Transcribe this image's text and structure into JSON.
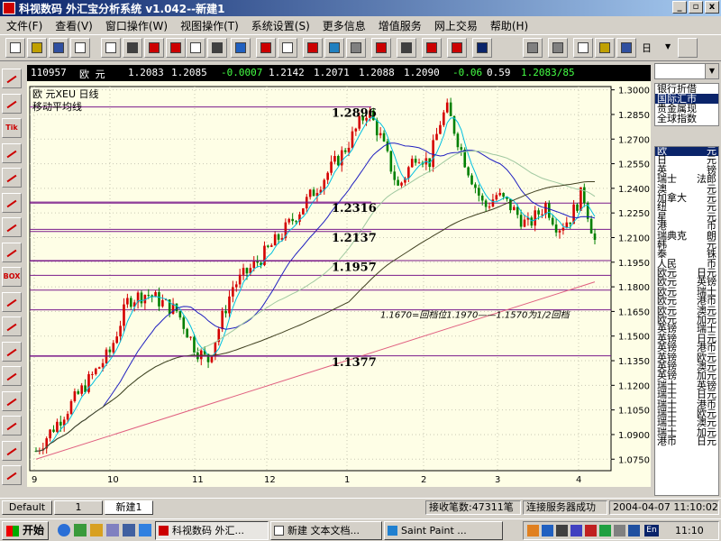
{
  "window": {
    "title": "科视数码 外汇宝分析系统 v1.042--新建1",
    "btn_min": "_",
    "btn_max": "▫",
    "btn_close": "x"
  },
  "menu": [
    "文件(F)",
    "查看(V)",
    "窗口操作(W)",
    "视图操作(T)",
    "系统设置(S)",
    "更多信息",
    "增值服务",
    "网上交易",
    "帮助(H)"
  ],
  "toolbar": {
    "period_label": "日"
  },
  "left_tools": [
    "Tik",
    "BOX"
  ],
  "quote": {
    "code": "110957",
    "name": "欧 元",
    "bid": "1.2083",
    "ask": "1.2085",
    "change": "-0.0007",
    "high": "1.2142",
    "low": "1.2071",
    "open": "1.2088",
    "prev": "1.2090",
    "chg2": "-0.06",
    "pct": "0.59",
    "last": "1.2083/85"
  },
  "chart_data": {
    "type": "candlestick",
    "title": "欧 元XEU 日线",
    "subtitle": "移动平均线",
    "x_ticks": [
      "9",
      "10",
      "11",
      "12",
      "1",
      "2",
      "3",
      "4"
    ],
    "y_ticks": [
      "1.3000",
      "1.2850",
      "1.2700",
      "1.2550",
      "1.2400",
      "1.2250",
      "1.2100",
      "1.1950",
      "1.1800",
      "1.1650",
      "1.1500",
      "1.1350",
      "1.1200",
      "1.1050",
      "1.0900",
      "1.0750"
    ],
    "ylim": [
      1.068,
      1.302
    ],
    "n_bars": 160,
    "levels": [
      {
        "value": 1.2896,
        "label": "1.2896"
      },
      {
        "value": 1.2316,
        "label": "1.2316"
      },
      {
        "value": 1.2137,
        "label": "1.2137"
      },
      {
        "value": 1.1957,
        "label": "1.1957"
      },
      {
        "value": 1.1377,
        "label": "1.1377"
      }
    ],
    "extra_lines": [
      1.231,
      1.215,
      1.196,
      1.187,
      1.178,
      1.166,
      1.138
    ],
    "annotation": "1.1670=回档位1.1970——1.1570为1/2回档"
  },
  "right_panel": {
    "categories": [
      "银行折借",
      "国际汇市",
      "贵金属现",
      "全球指数"
    ],
    "securities": [
      [
        "欧",
        "元"
      ],
      [
        "日",
        "元"
      ],
      [
        "英",
        "镑"
      ],
      [
        "瑞士",
        "法郎"
      ],
      [
        "澳",
        "元"
      ],
      [
        "加拿大",
        "元"
      ],
      [
        "纽",
        "元"
      ],
      [
        "星",
        "元"
      ],
      [
        "港",
        "币"
      ],
      [
        "瑞典克",
        "朗"
      ],
      [
        "韩",
        "元"
      ],
      [
        "泰",
        "铢"
      ],
      [
        "人民",
        "币"
      ],
      [
        "欧元",
        "日元"
      ],
      [
        "欧元",
        "英镑"
      ],
      [
        "欧元",
        "瑞士"
      ],
      [
        "欧元",
        "港币"
      ],
      [
        "欧元",
        "澳元"
      ],
      [
        "欧元",
        "加元"
      ],
      [
        "英镑",
        "瑞士"
      ],
      [
        "英镑",
        "日元"
      ],
      [
        "英镑",
        "港币"
      ],
      [
        "英镑",
        "欧元"
      ],
      [
        "英镑",
        "澳元"
      ],
      [
        "英镑",
        "加元"
      ],
      [
        "瑞士",
        "英镑"
      ],
      [
        "瑞士",
        "日元"
      ],
      [
        "瑞士",
        "港币"
      ],
      [
        "瑞士",
        "欧元"
      ],
      [
        "瑞士",
        "澳元"
      ],
      [
        "瑞士",
        "加元"
      ],
      [
        "港币",
        "日元"
      ]
    ]
  },
  "status": {
    "tabs": [
      "Default",
      "1",
      "新建1"
    ],
    "received": "接收笔数:47311笔",
    "connection": "连接服务器成功",
    "datetime": "2004-04-07 11:10:02"
  },
  "taskbar": {
    "start": "开始",
    "tasks": [
      "科视数码 外汇...",
      "新建 文本文档...",
      "Saint Paint ..."
    ],
    "tray_lang": "En",
    "clock": "11:10"
  }
}
